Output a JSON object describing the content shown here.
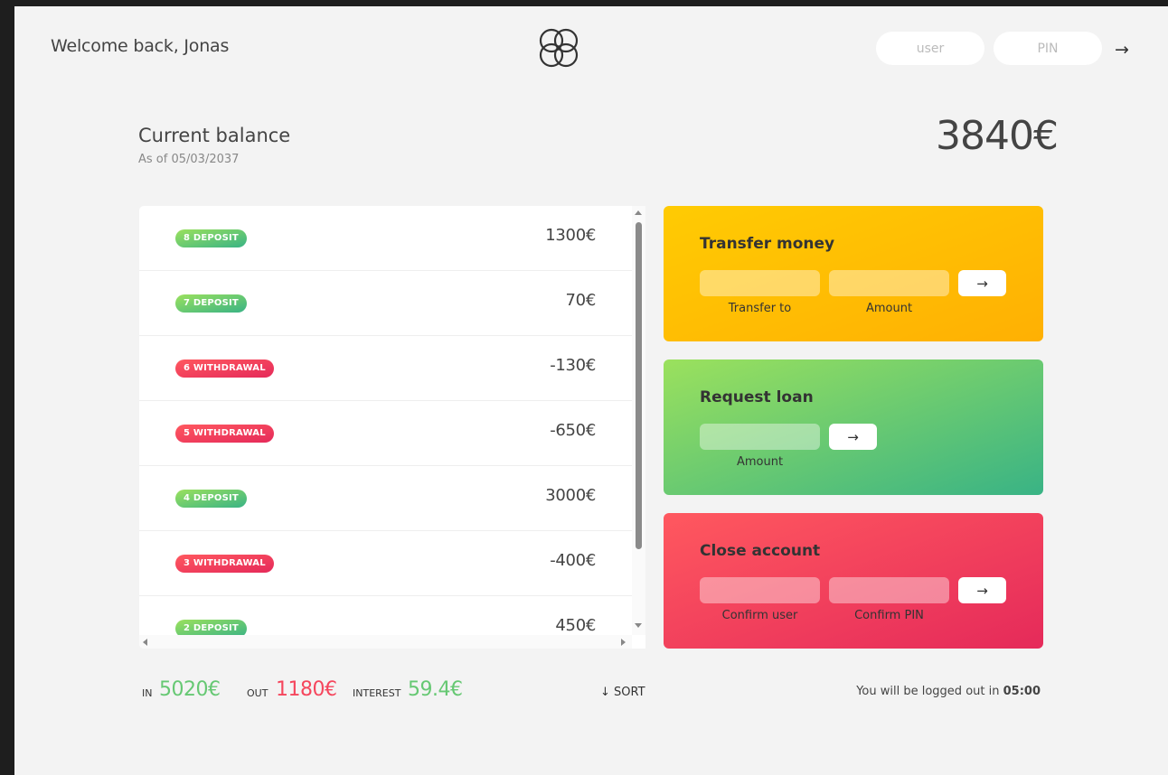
{
  "nav": {
    "welcome": "Welcome back, Jonas",
    "user_placeholder": "user",
    "pin_placeholder": "PIN",
    "login_btn": "→"
  },
  "balance": {
    "label": "Current balance",
    "date_prefix": "As of",
    "date": "05/03/2037",
    "value": "3840€"
  },
  "movements": [
    {
      "index": "8",
      "type": "deposit",
      "type_label": "8 DEPOSIT",
      "value": "1300€"
    },
    {
      "index": "7",
      "type": "deposit",
      "type_label": "7 DEPOSIT",
      "value": "70€"
    },
    {
      "index": "6",
      "type": "withdrawal",
      "type_label": "6 WITHDRAWAL",
      "value": "-130€"
    },
    {
      "index": "5",
      "type": "withdrawal",
      "type_label": "5 WITHDRAWAL",
      "value": "-650€"
    },
    {
      "index": "4",
      "type": "deposit",
      "type_label": "4 DEPOSIT",
      "value": "3000€"
    },
    {
      "index": "3",
      "type": "withdrawal",
      "type_label": "3 WITHDRAWAL",
      "value": "-400€"
    },
    {
      "index": "2",
      "type": "deposit",
      "type_label": "2 DEPOSIT",
      "value": "450€"
    }
  ],
  "operations": {
    "transfer": {
      "title": "Transfer money",
      "label_to": "Transfer to",
      "label_amount": "Amount",
      "btn": "→"
    },
    "loan": {
      "title": "Request loan",
      "label_amount": "Amount",
      "btn": "→"
    },
    "close": {
      "title": "Close account",
      "label_user": "Confirm user",
      "label_pin": "Confirm PIN",
      "btn": "→"
    }
  },
  "summary": {
    "in_label": "In",
    "in_value": "5020€",
    "out_label": "Out",
    "out_value": "1180€",
    "interest_label": "Interest",
    "interest_value": "59.4€",
    "sort_label": "↓ SORT"
  },
  "logout": {
    "text": "You will be logged out in",
    "timer": "05:00"
  },
  "colors": {
    "deposit": "#66c873",
    "withdrawal": "#f5465d",
    "transfer_bg": "#ffbb03",
    "loan_bg": "#6cc96f",
    "close_bg": "#f3475d"
  }
}
